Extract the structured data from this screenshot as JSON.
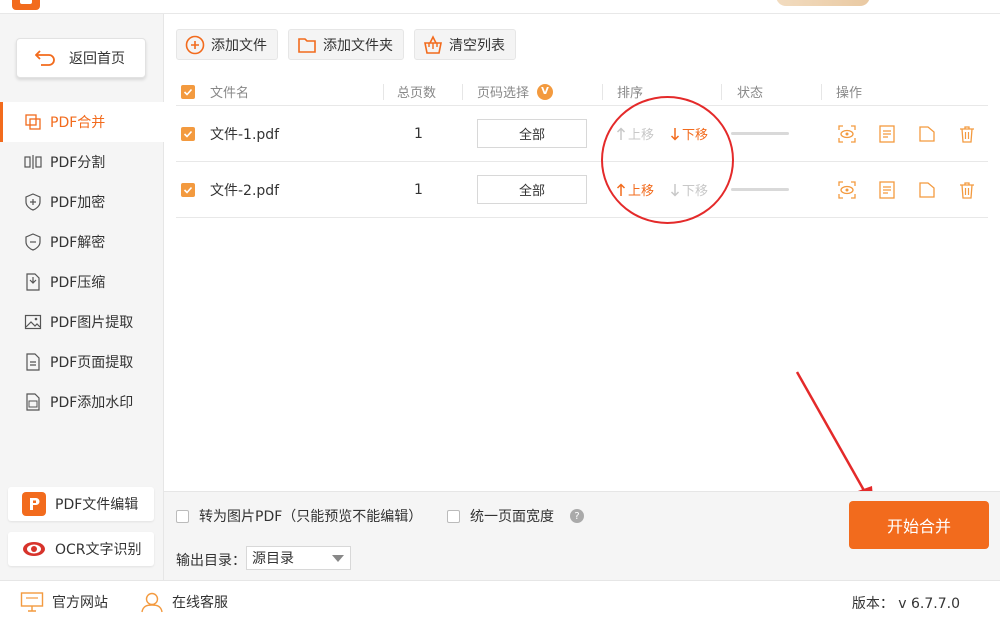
{
  "sidebar": {
    "home_label": "返回首页",
    "items": [
      {
        "label": "PDF合并",
        "icon": "merge-icon"
      },
      {
        "label": "PDF分割",
        "icon": "split-icon"
      },
      {
        "label": "PDF加密",
        "icon": "shield-plus-icon"
      },
      {
        "label": "PDF解密",
        "icon": "shield-minus-icon"
      },
      {
        "label": "PDF压缩",
        "icon": "compress-icon"
      },
      {
        "label": "PDF图片提取",
        "icon": "image-icon"
      },
      {
        "label": "PDF页面提取",
        "icon": "page-icon"
      },
      {
        "label": "PDF添加水印",
        "icon": "watermark-icon"
      }
    ],
    "active_index": 0,
    "pdf_edit_label": "PDF文件编辑",
    "ocr_label": "OCR文字识别"
  },
  "toolbar": {
    "add_file": "添加文件",
    "add_folder": "添加文件夹",
    "clear_list": "清空列表"
  },
  "table": {
    "headers": {
      "name": "文件名",
      "pages": "总页数",
      "page_select": "页码选择",
      "page_select_badge": "V",
      "order": "排序",
      "status": "状态",
      "actions": "操作"
    },
    "rows": [
      {
        "name": "文件-1.pdf",
        "pages": "1",
        "range": "全部",
        "up": "上移",
        "down": "下移",
        "up_enabled": false,
        "down_enabled": true,
        "progress": 0
      },
      {
        "name": "文件-2.pdf",
        "pages": "1",
        "range": "全部",
        "up": "上移",
        "down": "下移",
        "up_enabled": true,
        "down_enabled": false,
        "progress": 0
      }
    ]
  },
  "options": {
    "to_image_pdf": "转为图片PDF（只能预览不能编辑）",
    "uniform_width": "统一页面宽度",
    "output_label": "输出目录：",
    "output_value": "源目录"
  },
  "start_button": "开始合并",
  "statusbar": {
    "website": "官方网站",
    "support": "在线客服",
    "version": "版本：  v 6.7.7.0"
  },
  "colors": {
    "accent": "#f26b1d",
    "checkbox": "#f39a3f",
    "annotation": "#e42a2a"
  }
}
